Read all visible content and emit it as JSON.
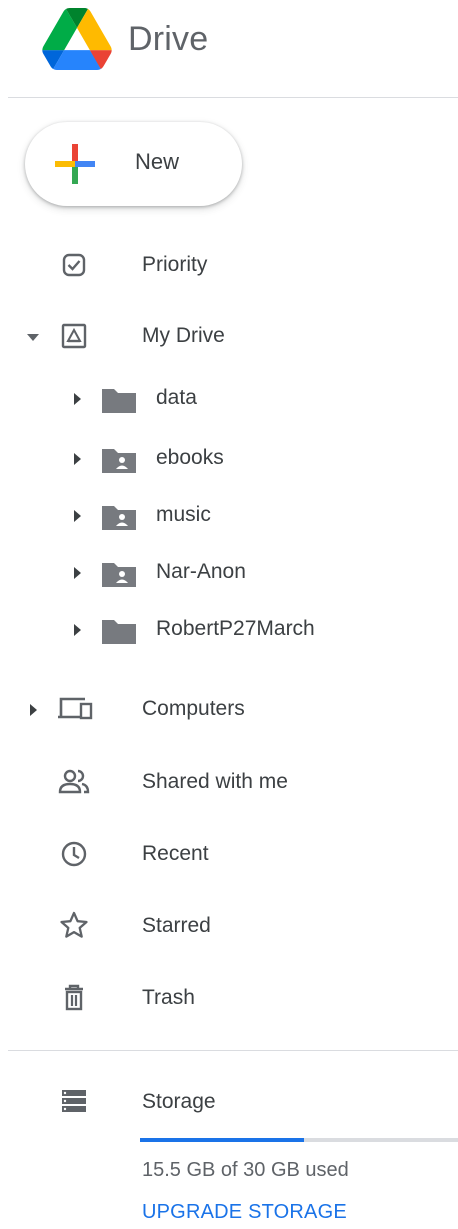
{
  "header": {
    "app_name": "Drive",
    "logo_icon": "google-drive-logo"
  },
  "new_button": {
    "label": "New",
    "icon": "plus-icon"
  },
  "nav": {
    "priority": {
      "label": "Priority",
      "icon": "check-circle-icon"
    },
    "my_drive": {
      "label": "My Drive",
      "icon": "drive-icon",
      "expanded": true,
      "folders": [
        {
          "label": "data",
          "shared": false
        },
        {
          "label": "ebooks",
          "shared": true
        },
        {
          "label": "music",
          "shared": true
        },
        {
          "label": "Nar-Anon",
          "shared": true
        },
        {
          "label": "RobertP27March",
          "shared": false
        }
      ]
    },
    "computers": {
      "label": "Computers",
      "icon": "computers-icon"
    },
    "shared": {
      "label": "Shared with me",
      "icon": "people-icon"
    },
    "recent": {
      "label": "Recent",
      "icon": "clock-icon"
    },
    "starred": {
      "label": "Starred",
      "icon": "star-icon"
    },
    "trash": {
      "label": "Trash",
      "icon": "trash-icon"
    }
  },
  "storage": {
    "label": "Storage",
    "icon": "storage-icon",
    "used_text": "15.5 GB of 30 GB used",
    "used_fraction": 0.517,
    "upgrade_label": "UPGRADE STORAGE"
  },
  "colors": {
    "accent": "#1a73e8",
    "text": "#3c4043",
    "icon": "#5f6368",
    "folder": "#5f6368"
  }
}
